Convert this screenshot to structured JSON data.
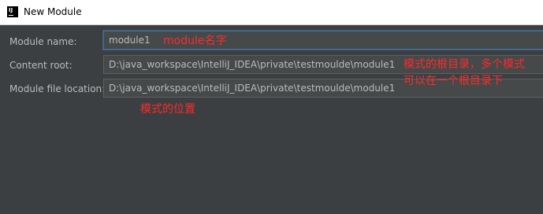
{
  "window": {
    "title": "New Module"
  },
  "form": {
    "module_name": {
      "label": "Module name:",
      "value": "module1"
    },
    "content_root": {
      "label": "Content root:",
      "value": "D:\\java_workspace\\IntelliJ_IDEA\\private\\testmoulde\\module1"
    },
    "module_file_location": {
      "label": "Module file location:",
      "value": "D:\\java_workspace\\IntelliJ_IDEA\\private\\testmoulde\\module1"
    }
  },
  "annotations": {
    "module_name_note": "module名字",
    "content_root_note_line1": "模式的根目录，多个模式",
    "content_root_note_line2": "可以在一个根目录下",
    "file_location_note": "模式的位置"
  },
  "colors": {
    "background": "#3c3f41",
    "field_background": "#45494a",
    "field_border": "#5e6060",
    "focus_border": "#466d94",
    "label_text": "#bbbbbb",
    "annotation_text": "#ff2a2a",
    "titlebar_background": "#ffffff"
  },
  "icons": {
    "app_icon": "intellij-idea-icon"
  }
}
